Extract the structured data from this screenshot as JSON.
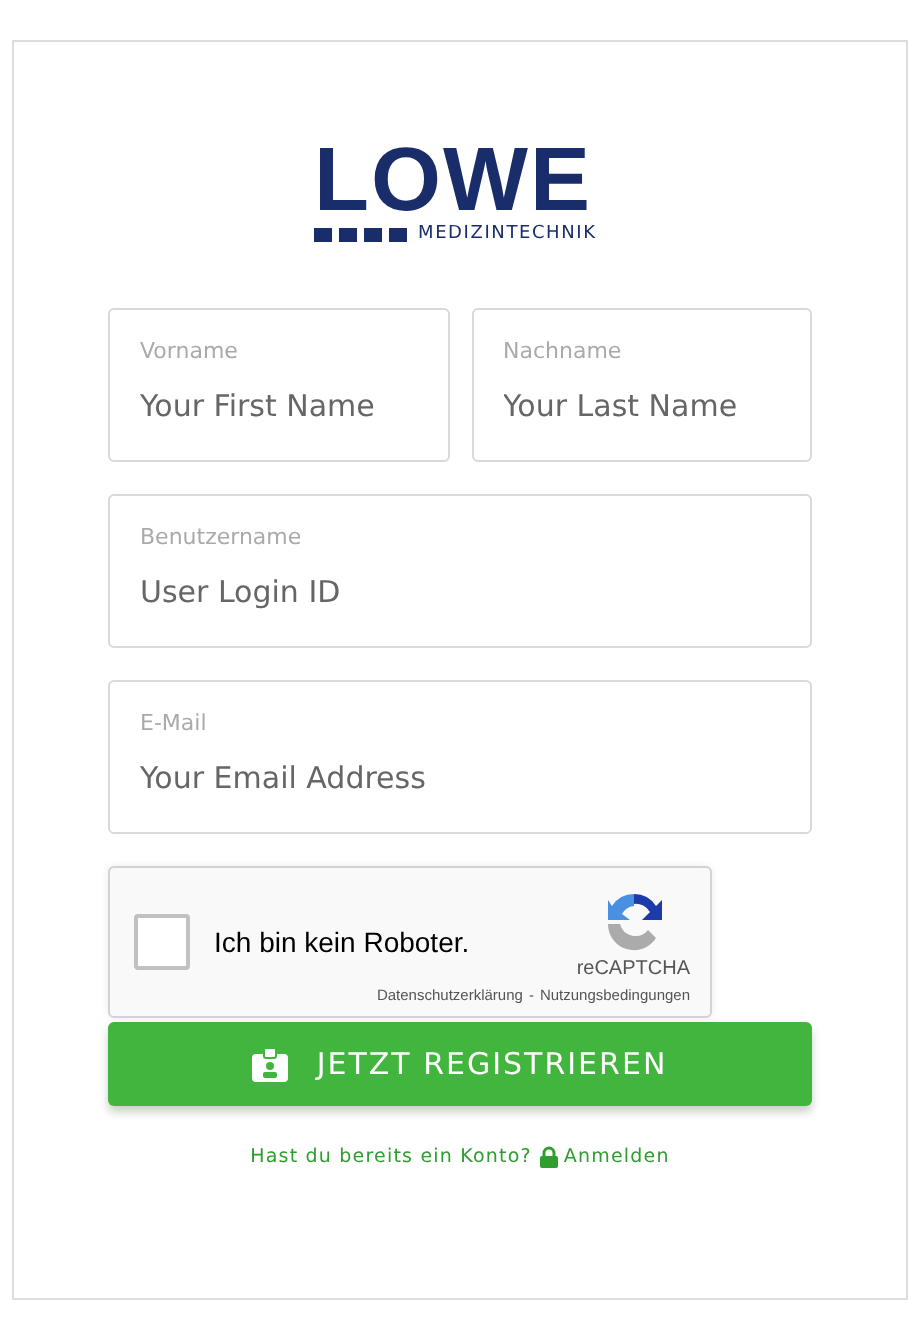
{
  "logo": {
    "name": "LOWE",
    "subtitle": "MEDIZINTECHNIK"
  },
  "name_fields": [
    {
      "label": "Vorname",
      "placeholder": "Your First Name"
    },
    {
      "label": "Nachname",
      "placeholder": "Your Last Name"
    }
  ],
  "fields": [
    {
      "label": "Benutzername",
      "placeholder": "User Login ID"
    },
    {
      "label": "E-Mail",
      "placeholder": "Your Email Address"
    }
  ],
  "captcha": {
    "label": "Ich bin kein Roboter.",
    "checked": false,
    "brand": "reCAPTCHA",
    "privacy": "Datenschutzerklärung",
    "separator": "-",
    "terms": "Nutzungsbedingungen"
  },
  "submit": "JETZT REGISTRIEREN",
  "footer": {
    "question": "Hast du bereits ein Konto?",
    "link": "Anmelden"
  }
}
